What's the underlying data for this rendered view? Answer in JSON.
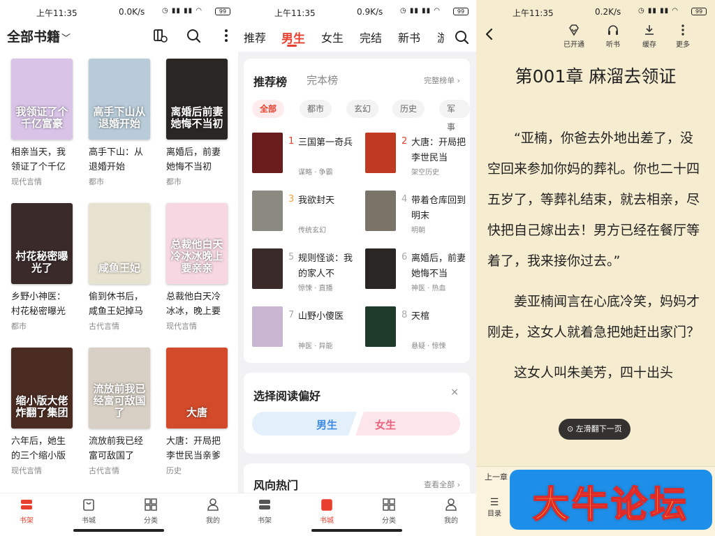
{
  "statusbars": [
    {
      "time": "上午11:35",
      "speed": "0.0K/s",
      "battery": "99"
    },
    {
      "time": "上午11:35",
      "speed": "0.9K/s",
      "battery": "99"
    },
    {
      "time": "上午11:35",
      "speed": "0.2K/s",
      "battery": "99"
    }
  ],
  "shelf": {
    "title": "全部书籍",
    "books": [
      {
        "title": "相亲当天，我领证了个千亿",
        "category": "现代言情",
        "cover_text": "我领证了个千亿富豪",
        "cover_color": "#d9c4e8"
      },
      {
        "title": "高手下山：从退婚开始",
        "category": "都市",
        "cover_text": "高手下山从退婚开始",
        "cover_color": "#b7cbd8"
      },
      {
        "title": "离婚后，前妻她悔不当初",
        "category": "都市",
        "cover_text": "离婚后前妻她悔不当初",
        "cover_color": "#2a2624"
      },
      {
        "title": "乡野小神医：村花秘密曝光",
        "category": "都市",
        "cover_text": "村花秘密曝光了",
        "cover_color": "#3a2a2a"
      },
      {
        "title": "偷到休书后，咸鱼王妃掉马",
        "category": "古代言情",
        "cover_text": "咸鱼王妃",
        "cover_color": "#e8e2d0"
      },
      {
        "title": "总裁他白天冷冰冰，晚上要",
        "category": "现代言情",
        "cover_text": "总裁他白天冷冰冰晚上要亲亲",
        "cover_color": "#f7d8e2"
      },
      {
        "title": "六年后，她生的三个缩小版",
        "category": "现代言情",
        "cover_text": "缩小版大佬炸翻了集团",
        "cover_color": "#4a2c22"
      },
      {
        "title": "流放前我已经富可敌国了",
        "category": "古代言情",
        "cover_text": "流放前我已经富可敌国了",
        "cover_color": "#d8d0c4"
      },
      {
        "title": "大唐：开局把李世民当亲爹",
        "category": "历史",
        "cover_text": "大唐",
        "cover_color": "#d24a2a"
      }
    ],
    "tabs": [
      {
        "label": "书架",
        "icon": "bookshelf-icon",
        "active": true
      },
      {
        "label": "书城",
        "icon": "store-bag-icon",
        "active": false
      },
      {
        "label": "分类",
        "icon": "grid-icon",
        "active": false
      },
      {
        "label": "我的",
        "icon": "profile-icon",
        "active": false
      }
    ]
  },
  "store": {
    "categories": [
      "推荐",
      "男生",
      "女生",
      "完结",
      "新书",
      "游"
    ],
    "rank_tabs": [
      "推荐榜",
      "完本榜"
    ],
    "full_rank": "完整榜单",
    "chips": [
      "全部",
      "都市",
      "玄幻",
      "历史",
      "军事"
    ],
    "ranks": [
      {
        "no": "1",
        "title": "三国第一奇兵",
        "meta": "谋略 · 争霸",
        "color": "#6a1c1c"
      },
      {
        "no": "2",
        "title": "大唐：开局把李世民当",
        "meta": "架空历史",
        "color": "#c03a22"
      },
      {
        "no": "3",
        "title": "我欲封天",
        "meta": "传统玄幻",
        "color": "#8a8a80"
      },
      {
        "no": "4",
        "title": "带着仓库回到明末",
        "meta": "明朝",
        "color": "#7a7468"
      },
      {
        "no": "5",
        "title": "规则怪谈：我的家人不",
        "meta": "惊悚 · 直播",
        "color": "#3a2a2a"
      },
      {
        "no": "6",
        "title": "离婚后，前妻她悔不当",
        "meta": "神医 · 热血",
        "color": "#2a2624"
      },
      {
        "no": "7",
        "title": "山野小傻医",
        "meta": "神医 · 异能",
        "color": "#c9b6d2"
      },
      {
        "no": "8",
        "title": "天棺",
        "meta": "悬疑 · 惊悚",
        "color": "#1e3a2a"
      }
    ],
    "pref_title": "选择阅读偏好",
    "pref_close": "×",
    "pref_male": "男生",
    "pref_female": "女生",
    "trend_title": "风向热门",
    "trend_more": "查看全部",
    "tabs": [
      {
        "label": "书架",
        "icon": "bookshelf-icon",
        "active": false
      },
      {
        "label": "书城",
        "icon": "store-bag-icon",
        "active": true
      },
      {
        "label": "分类",
        "icon": "grid-icon",
        "active": false
      },
      {
        "label": "我的",
        "icon": "profile-icon",
        "active": false
      }
    ]
  },
  "reader": {
    "tools": [
      {
        "label": "已开通",
        "icon": "vip-diamond-icon"
      },
      {
        "label": "听书",
        "icon": "headphones-icon"
      },
      {
        "label": "缓存",
        "icon": "download-icon"
      },
      {
        "label": "更多",
        "icon": "more-vertical-icon"
      }
    ],
    "chapter_title": "第001章 麻溜去领证",
    "paragraphs": [
      "“亚楠，你爸去外地出差了，没空回来参加你妈的葬礼。你也二十四五岁了，等葬礼结束，就去相亲，尽快把自己嫁出去！男方已经在餐厅等着了，我来接你过去。”",
      "姜亚楠闻言在心底冷笑，妈妈才刚走，这女人就着急把她赶出家门？",
      "这女人叫朱美芳，四十出头"
    ],
    "swipe_tip": "左滑翻下一页",
    "prev_chapter": "上一章",
    "toc": "目录",
    "watermark": "大牛论坛"
  },
  "colors": {
    "accent": "#e8402f",
    "reader_bg": "#f6ecd0",
    "watermark_bg": "#1e8fe8",
    "watermark_text": "#f7e541"
  }
}
